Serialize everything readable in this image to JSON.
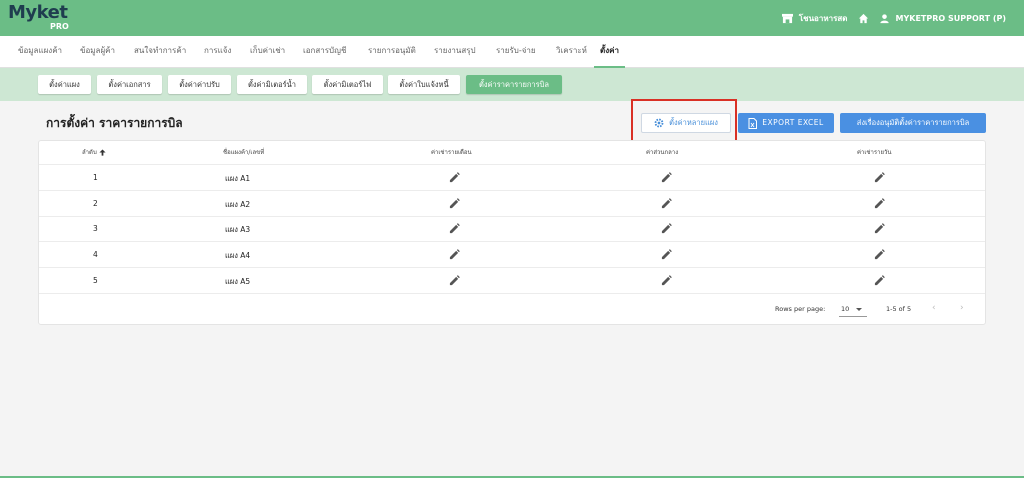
{
  "header": {
    "logo_text": "Myket",
    "logo_sub": "PRO",
    "store_label": "โชนอาหารสด",
    "user_label": "MYKETPRO SUPPORT (P)"
  },
  "nav": {
    "items": [
      "ข้อมูลแผงค้า",
      "ข้อมูลผู้ค้า",
      "สนใจทำการค้า",
      "การแจ้ง",
      "เก็บค่าเช่า",
      "เอกสารบัญชี",
      "รายการอนุมัติ",
      "รายงานสรุป",
      "รายรับ-จ่าย",
      "วิเคราะห์",
      "ตั้งค่า"
    ],
    "active_index": 10
  },
  "subnav": {
    "items": [
      "ตั้งค่าแผง",
      "ตั้งค่าเอกสาร",
      "ตั้งค่าค่าปรับ",
      "ตั้งค่ามิเตอร์น้ำ",
      "ตั้งค่ามิเตอร์ไฟ",
      "ตั้งค่าใบแจ้งหนี้",
      "ตั้งค่าราคารายการบิล"
    ],
    "active_index": 6
  },
  "page": {
    "title": "การตั้งค่า ราคารายการบิล",
    "btn_multi": "ตั้งค่าหลายแผง",
    "btn_excel": "EXPORT EXCEL",
    "btn_send": "ส่งเรื่องอนุมัติตั้งค่าราคารายการบิล"
  },
  "table": {
    "headers": [
      "ลำดับ",
      "ชื่อแผงค้า/เลขที่",
      "ค่าเช่ารายเดือน",
      "ค่าส่วนกลาง",
      "ค่าเช่ารายวัน"
    ],
    "sort_icon": "arrow-up-icon",
    "rows": [
      {
        "no": "1",
        "name": "แผง A1"
      },
      {
        "no": "2",
        "name": "แผง A2"
      },
      {
        "no": "3",
        "name": "แผง A3"
      },
      {
        "no": "4",
        "name": "แผง A4"
      },
      {
        "no": "5",
        "name": "แผง A5"
      }
    ]
  },
  "pagination": {
    "rows_per_page_label": "Rows per page:",
    "rows_per_page_value": "10",
    "range_text": "1-5 of 5"
  },
  "colors": {
    "brand_green": "#6bbd86",
    "subbar_green": "#cde7d3",
    "primary_blue": "#4a90e2",
    "highlight_red": "#d93025"
  }
}
